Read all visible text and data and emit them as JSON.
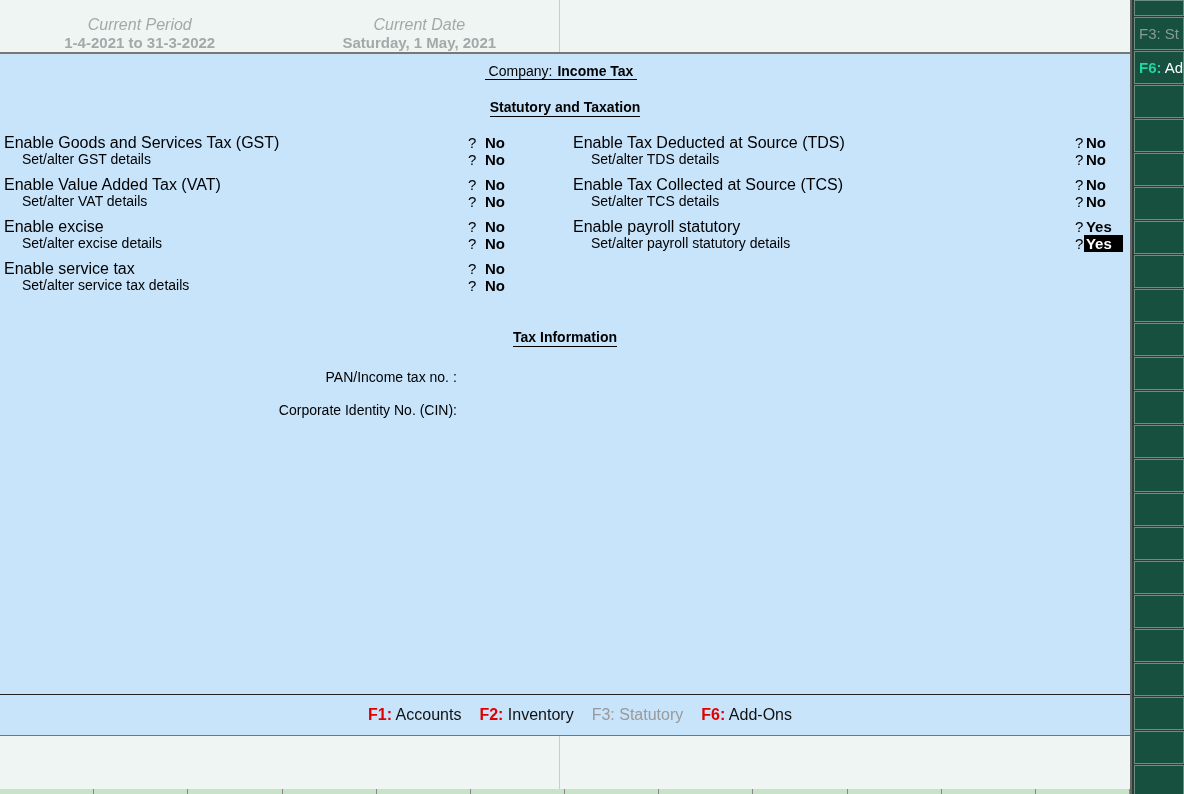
{
  "header": {
    "period_label": "Current Period",
    "period": "1-4-2021 to 31-3-2022",
    "date_label": "Current Date",
    "date": "Saturday, 1 May, 2021"
  },
  "company": {
    "label": "Company:",
    "name": "Income Tax"
  },
  "section_title": "Statutory and Taxation",
  "columns": [
    [
      {
        "kind": "main",
        "label": "Enable Goods and Services Tax (GST)",
        "prompt": "?",
        "value": "No",
        "selected": false
      },
      {
        "kind": "sub",
        "label": "Set/alter GST details",
        "prompt": "?",
        "value": "No",
        "selected": false
      },
      {
        "kind": "main",
        "label": "Enable Value Added Tax (VAT)",
        "prompt": "?",
        "value": "No",
        "selected": false
      },
      {
        "kind": "sub",
        "label": "Set/alter VAT details",
        "prompt": "?",
        "value": "No",
        "selected": false
      },
      {
        "kind": "main",
        "label": "Enable excise",
        "prompt": "?",
        "value": "No",
        "selected": false
      },
      {
        "kind": "sub",
        "label": "Set/alter excise details",
        "prompt": "?",
        "value": "No",
        "selected": false
      },
      {
        "kind": "main",
        "label": "Enable service tax",
        "prompt": "?",
        "value": "No",
        "selected": false
      },
      {
        "kind": "sub",
        "label": "Set/alter service tax details",
        "prompt": "?",
        "value": "No",
        "selected": false
      }
    ],
    [
      {
        "kind": "main",
        "label": "Enable Tax Deducted at Source (TDS)",
        "prompt": "?",
        "value": "No",
        "selected": false
      },
      {
        "kind": "sub",
        "label": "Set/alter TDS details",
        "prompt": "?",
        "value": "No",
        "selected": false
      },
      {
        "kind": "main",
        "label": "Enable Tax Collected at Source (TCS)",
        "prompt": "?",
        "value": "No",
        "selected": false
      },
      {
        "kind": "sub",
        "label": "Set/alter TCS details",
        "prompt": "?",
        "value": "No",
        "selected": false
      },
      {
        "kind": "main",
        "label": "Enable payroll statutory",
        "prompt": "?",
        "value": "Yes",
        "selected": false
      },
      {
        "kind": "sub",
        "label": "Set/alter payroll statutory details",
        "prompt": "?",
        "value": "Yes",
        "selected": true
      }
    ]
  ],
  "tax_title": "Tax Information",
  "tax_fields": [
    {
      "label": "PAN/Income tax no.",
      "colon": ":"
    },
    {
      "label": "Corporate Identity No. (CIN):"
    }
  ],
  "footer_tabs": [
    {
      "key": "F1:",
      "label": "Accounts",
      "disabled": false
    },
    {
      "key": "F2:",
      "label": "Inventory",
      "disabled": false
    },
    {
      "key": "F3:",
      "label": "Statutory",
      "disabled": true
    },
    {
      "key": "F6:",
      "label": "Add-Ons",
      "disabled": false
    }
  ],
  "sidebar": [
    {
      "key": "F3:",
      "label": "St",
      "disabled": true
    },
    {
      "key": "F6:",
      "label": "Ad",
      "disabled": false
    }
  ]
}
